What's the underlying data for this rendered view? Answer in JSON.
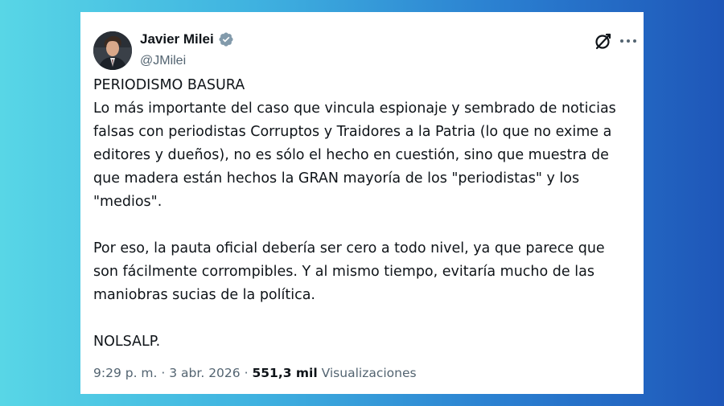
{
  "tweet": {
    "author": {
      "name": "Javier Milei",
      "handle": "@JMilei",
      "verified": true
    },
    "text": {
      "heading": "PERIODISMO BASURA",
      "paragraph_1": "Lo más importante del caso que vincula espionaje y sembrado de noticias falsas con periodistas Corruptos y Traidores a la Patria (lo que no exime a editores y dueños), no es sólo el hecho en cuestión, sino que muestra de que madera están hechos la GRAN mayoría de los \"periodistas\" y los \"medios\".",
      "paragraph_2": "Por eso, la pauta oficial debería ser cero a todo nivel, ya que parece que son fácilmente corrompibles. Y al mismo tiempo, evitaría mucho de las maniobras sucias de la política.",
      "closing": "NOLSALP."
    },
    "meta": {
      "time": "9:29 p. m.",
      "separator": "·",
      "date": "3 abr. 2026",
      "views_count": "551,3 mil",
      "views_label": "Visualizaciones"
    },
    "icons": {
      "grok": "grok-icon",
      "more": "more-options-icon",
      "verified": "verified-badge-icon"
    },
    "colors": {
      "text_primary": "#0f1419",
      "text_secondary": "#536471",
      "verified_badge": "#829aab",
      "card_background": "#ffffff"
    }
  }
}
